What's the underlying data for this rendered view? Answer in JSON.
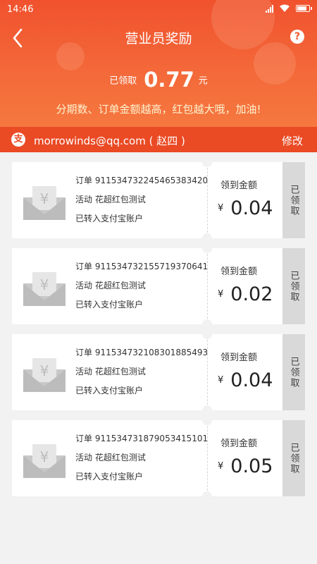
{
  "status_bar": {
    "time": "14:46"
  },
  "nav": {
    "title": "营业员奖励",
    "help_label": "?"
  },
  "summary": {
    "label": "已领取",
    "amount": "0.77",
    "unit": "元",
    "slogan": "分期数、订单金额越高，红包越大哦，加油!"
  },
  "account": {
    "icon_char": "支",
    "text": "morrowinds@qq.com ( 赵四 )",
    "modify_label": "修改"
  },
  "colors": {
    "header_red": "#f0522e",
    "account_bar": "#ea4a24",
    "slogan_yellow": "#fff3cf",
    "status_tag_gray": "#d9d9d9"
  },
  "cards": [
    {
      "order": "订单 911534732245465383420",
      "activity": "活动 花超红包测试",
      "transfer": "已转入支付宝账户",
      "amount_label": "领到金额",
      "currency": "¥",
      "amount": "0.04",
      "status": "已领取"
    },
    {
      "order": "订单 911534732155719370641",
      "activity": "活动 花超红包测试",
      "transfer": "已转入支付宝账户",
      "amount_label": "领到金额",
      "currency": "¥",
      "amount": "0.02",
      "status": "已领取"
    },
    {
      "order": "订单 911534732108301885493",
      "activity": "活动 花超红包测试",
      "transfer": "已转入支付宝账户",
      "amount_label": "领到金额",
      "currency": "¥",
      "amount": "0.04",
      "status": "已领取"
    },
    {
      "order": "订单 911534731879053415101",
      "activity": "活动 花超红包测试",
      "transfer": "已转入支付宝账户",
      "amount_label": "领到金额",
      "currency": "¥",
      "amount": "0.05",
      "status": "已领取"
    }
  ]
}
